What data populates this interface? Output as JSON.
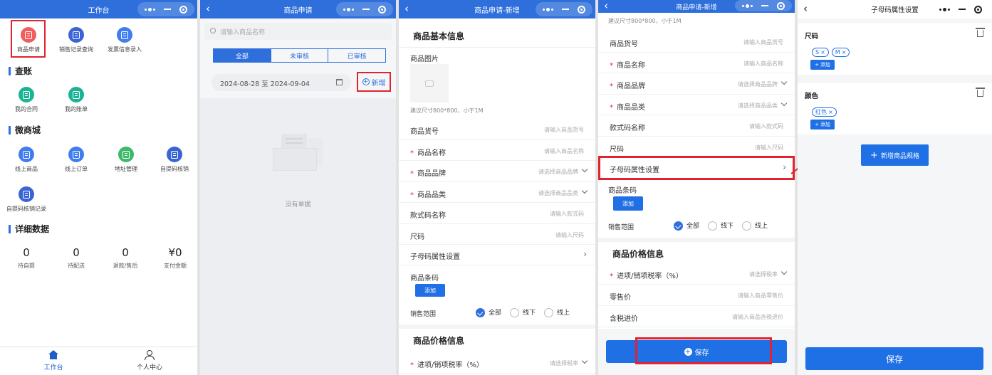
{
  "colors": {
    "primary": "#2f6fdc",
    "button": "#1f6fe5",
    "highlight": "#e0232e",
    "icon_red": "#f35d5d",
    "icon_blue": "#3f7df0",
    "icon_teal": "#1ab394",
    "icon_green": "#3cba6a",
    "icon_navy": "#3a63d6"
  },
  "panel1": {
    "nav_title": "工作台",
    "top_items": [
      {
        "label": "商品申请",
        "icon": "bag-icon",
        "color": "#f35d5d"
      },
      {
        "label": "销售记录查询",
        "icon": "record-icon",
        "color": "#3a63d6"
      },
      {
        "label": "发票信息录入",
        "icon": "invoice-icon",
        "color": "#3f7df0"
      }
    ],
    "section_account": "查账",
    "account_items": [
      {
        "label": "我的合同",
        "icon": "contract-icon",
        "color": "#1ab394"
      },
      {
        "label": "我的账单",
        "icon": "bill-icon",
        "color": "#1ab394"
      }
    ],
    "section_mall": "微商城",
    "mall_items": [
      {
        "label": "线上商品",
        "icon": "product-icon",
        "color": "#3f7df0"
      },
      {
        "label": "线上订单",
        "icon": "order-icon",
        "color": "#3f7df0"
      },
      {
        "label": "地址管理",
        "icon": "address-icon",
        "color": "#3cba6a"
      },
      {
        "label": "自提码核销",
        "icon": "verify-icon",
        "color": "#3a63d6"
      },
      {
        "label": "自提码核销记录",
        "icon": "verify-record-icon",
        "color": "#3a63d6"
      }
    ],
    "section_detail": "详细数据",
    "stats": [
      {
        "value": "0",
        "label": "待自提"
      },
      {
        "value": "0",
        "label": "待配送"
      },
      {
        "value": "0",
        "label": "退款/售后"
      },
      {
        "value": "¥0",
        "label": "支付金额"
      }
    ],
    "tabbar": [
      {
        "label": "工作台",
        "icon": "home-icon"
      },
      {
        "label": "个人中心",
        "icon": "user-icon"
      }
    ]
  },
  "panel2": {
    "nav_title": "商品申请",
    "search_placeholder": "请输入商品名称",
    "tabs": [
      "全部",
      "未审核",
      "已审核"
    ],
    "date_range": "2024-08-28 至 2024-09-04",
    "add_label": "新增",
    "empty_text": "没有单据"
  },
  "panel3": {
    "nav_title": "商品申请-新增",
    "section_basic": "商品基本信息",
    "image_label": "商品图片",
    "image_hint": "建议尺寸800*800，小于1M",
    "rows": [
      {
        "label": "商品货号",
        "placeholder": "请输入商品货号",
        "required": false
      },
      {
        "label": "商品名称",
        "placeholder": "请输入商品名称",
        "required": true
      },
      {
        "label": "商品品牌",
        "placeholder": "请选择商品品牌",
        "required": true,
        "select": true
      },
      {
        "label": "商品品类",
        "placeholder": "请选择商品品类",
        "required": true,
        "select": true
      },
      {
        "label": "款式码名称",
        "placeholder": "请输入款式码",
        "required": false
      },
      {
        "label": "尺码",
        "placeholder": "请输入尺码",
        "required": false
      }
    ],
    "sub_attr_label": "子母码属性设置",
    "barcode_label": "商品条码",
    "barcode_add": "添加",
    "sale_range_label": "销售范围",
    "sale_options": [
      "全部",
      "线下",
      "线上"
    ],
    "section_price": "商品价格信息",
    "tax_label": "进项/销项税率（%）",
    "tax_placeholder": "请选择税率"
  },
  "panel4": {
    "nav_title": "商品申请-新增",
    "top_hint": "建议尺寸800*800，小于1M",
    "rows": [
      {
        "label": "商品货号",
        "placeholder": "请输入商品货号",
        "required": false
      },
      {
        "label": "商品名称",
        "placeholder": "请输入商品名称",
        "required": true
      },
      {
        "label": "商品品牌",
        "placeholder": "请选择商品品牌",
        "required": true,
        "select": true
      },
      {
        "label": "商品品类",
        "placeholder": "请选择商品品类",
        "required": true,
        "select": true
      },
      {
        "label": "款式码名称",
        "placeholder": "请输入款式码",
        "required": false
      },
      {
        "label": "尺码",
        "placeholder": "请输入尺码",
        "required": false
      }
    ],
    "sub_attr_label": "子母码属性设置",
    "barcode_label": "商品条码",
    "barcode_add": "添加",
    "sale_range_label": "销售范围",
    "sale_options": [
      "全部",
      "线下",
      "线上"
    ],
    "section_price": "商品价格信息",
    "price_rows": [
      {
        "label": "进项/销项税率（%）",
        "placeholder": "请选择税率",
        "required": true,
        "select": true
      },
      {
        "label": "零售价",
        "placeholder": "请输入商品零售价",
        "required": false
      },
      {
        "label": "含税进价",
        "placeholder": "请输入商品含税进价",
        "required": false
      }
    ],
    "save_label": "保存"
  },
  "panel5": {
    "nav_title": "子母码属性设置",
    "groups": [
      {
        "title": "尺码",
        "tags": [
          "S",
          "M"
        ],
        "add": "添加"
      },
      {
        "title": "颜色",
        "tags": [
          "红色"
        ],
        "add": "添加"
      }
    ],
    "new_spec_label": "新增商品规格",
    "save_label": "保存"
  }
}
